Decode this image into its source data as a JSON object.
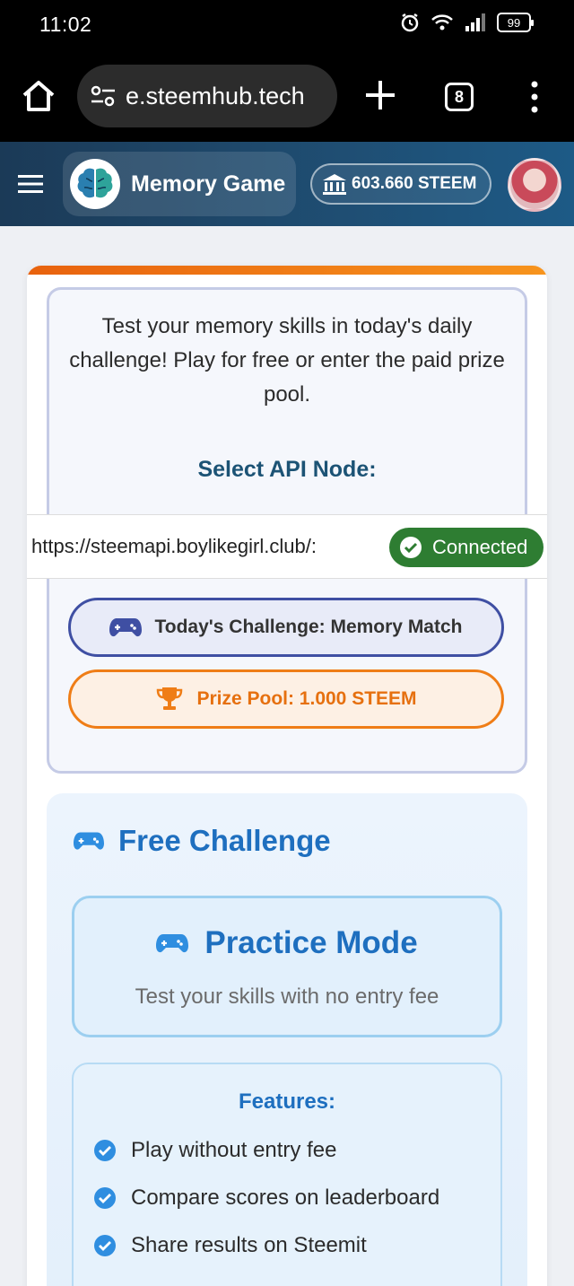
{
  "status_bar": {
    "time": "11:02",
    "battery": "99"
  },
  "browser": {
    "url": "e.steemhub.tech",
    "tab_count": "8"
  },
  "header": {
    "title": "Memory Game",
    "balance": "603.660 STEEM"
  },
  "intro": {
    "text": "Test your memory skills in today's daily challenge! Play for free or enter the paid prize pool."
  },
  "api_node": {
    "label": "Select API Node:",
    "url": "https://steemapi.boylikegirl.club/:",
    "status": "Connected",
    "status_color": "#2e7d32"
  },
  "challenge": {
    "label": "Today's Challenge: Memory Match"
  },
  "prize": {
    "label": "Prize Pool: 1.000 STEEM",
    "color": "#ef7d16"
  },
  "free_challenge": {
    "title": "Free Challenge",
    "practice_title": "Practice Mode",
    "practice_subtitle": "Test your skills with no entry fee",
    "features_title": "Features:",
    "features": [
      "Play without entry fee",
      "Compare scores on leaderboard",
      "Share results on Steemit"
    ]
  },
  "colors": {
    "accent_blue": "#1e6fbf",
    "header_bg": "#1f4e73",
    "accent_orange": "#f7941d"
  }
}
